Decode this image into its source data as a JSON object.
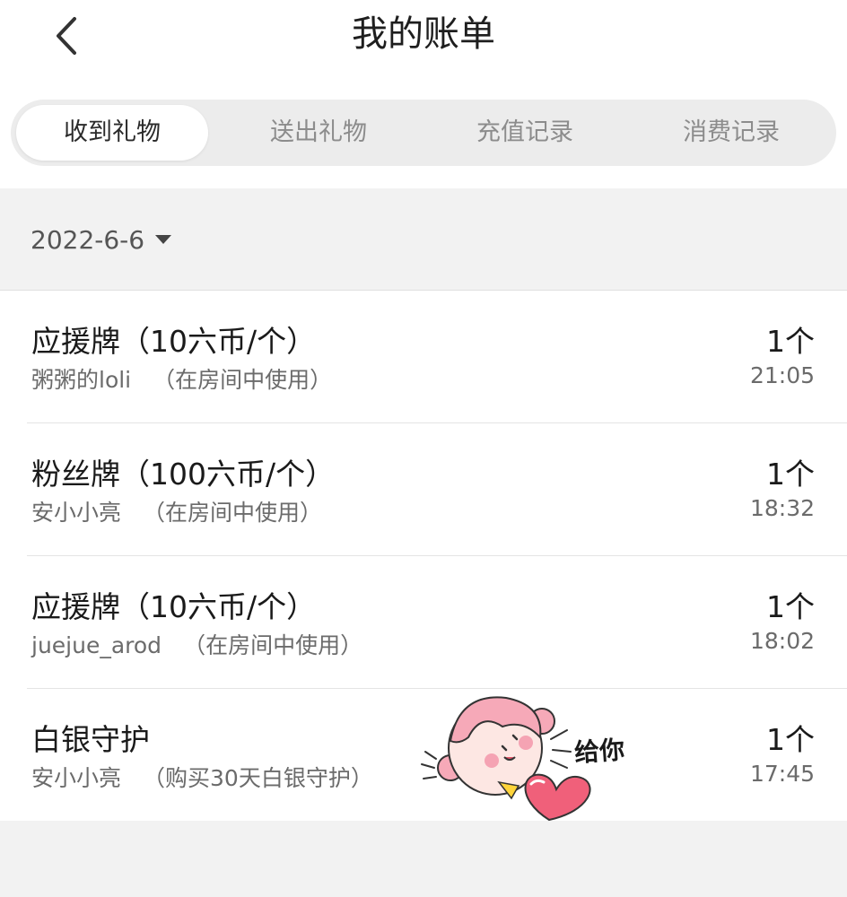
{
  "header": {
    "title": "我的账单",
    "back_icon": "chevron-left-icon"
  },
  "tabs": [
    {
      "label": "收到礼物",
      "active": true
    },
    {
      "label": "送出礼物",
      "active": false
    },
    {
      "label": "充值记录",
      "active": false
    },
    {
      "label": "消费记录",
      "active": false
    }
  ],
  "date_filter": {
    "value": "2022-6-6",
    "icon": "caret-down-icon"
  },
  "records": [
    {
      "gift": "应援牌（10六币/个）",
      "user": "粥粥的loli",
      "note": "（在房间中使用）",
      "qty": "1个",
      "time": "21:05"
    },
    {
      "gift": "粉丝牌（100六币/个）",
      "user": "安小小亮",
      "note": "（在房间中使用）",
      "qty": "1个",
      "time": "18:32"
    },
    {
      "gift": "应援牌（10六币/个）",
      "user": "juejue_arod",
      "note": "（在房间中使用）",
      "qty": "1个",
      "time": "18:02"
    },
    {
      "gift": "白银守护",
      "user": "安小小亮",
      "note": "（购买30天白银守护）",
      "qty": "1个",
      "time": "17:45"
    }
  ],
  "sticker": {
    "text": "给你",
    "accent": "#f6a9b8",
    "heart_color": "#f0607a"
  },
  "colors": {
    "background": "#f2f2f2",
    "tab_track": "#ececec",
    "active_tab": "#ffffff"
  }
}
